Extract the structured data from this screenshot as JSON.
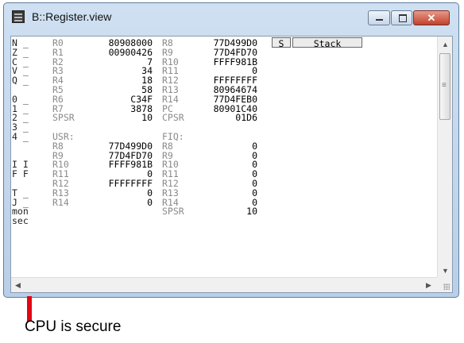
{
  "window": {
    "title": "B::Register.view"
  },
  "buttons": {
    "s": "S",
    "stack": "Stack"
  },
  "flags": [
    "N _",
    "Z _",
    "C _",
    "V _",
    "Q _",
    "",
    "0 _",
    "1 _",
    "2 _",
    "3 _",
    "4 _",
    "",
    "",
    "I I",
    "F F",
    "",
    "T _",
    "J _",
    "mon",
    "sec"
  ],
  "cols": {
    "c1n": [
      "R0",
      "R1",
      "R2",
      "R3",
      "R4",
      "R5",
      "R6",
      "R7",
      "SPSR",
      "",
      "USR:",
      "R8",
      "R9",
      "R10",
      "R11",
      "R12",
      "R13",
      "R14",
      "",
      ""
    ],
    "c1v": [
      "80908000",
      "00900426",
      "7",
      "34",
      "18",
      "58",
      "C34F",
      "3878",
      "10",
      "",
      "",
      "77D499D0",
      "77D4FD70",
      "FFFF981B",
      "0",
      "FFFFFFFF",
      "0",
      "0",
      "",
      ""
    ],
    "c2n": [
      "R8",
      "R9",
      "R10",
      "R11",
      "R12",
      "R13",
      "R14",
      "PC",
      "CPSR",
      "",
      "FIQ:",
      "R8",
      "R9",
      "R10",
      "R11",
      "R12",
      "R13",
      "R14",
      "SPSR",
      ""
    ],
    "c2v": [
      "77D499D0",
      "77D4FD70",
      "FFFF981B",
      "0",
      "FFFFFFFF",
      "80964674",
      "77D4FEB0",
      "80901C40",
      "01D6",
      "",
      "",
      "0",
      "0",
      "0",
      "0",
      "0",
      "0",
      "0",
      "10",
      ""
    ]
  },
  "annotation": "CPU is secure",
  "colors": {
    "marker": "#e30613",
    "titlebar": "#c4d7ee",
    "close_button": "#c2412d"
  },
  "icons": {
    "app": "register-window-icon",
    "minimize": "minimize-icon",
    "maximize": "maximize-icon",
    "close": "close-icon"
  }
}
